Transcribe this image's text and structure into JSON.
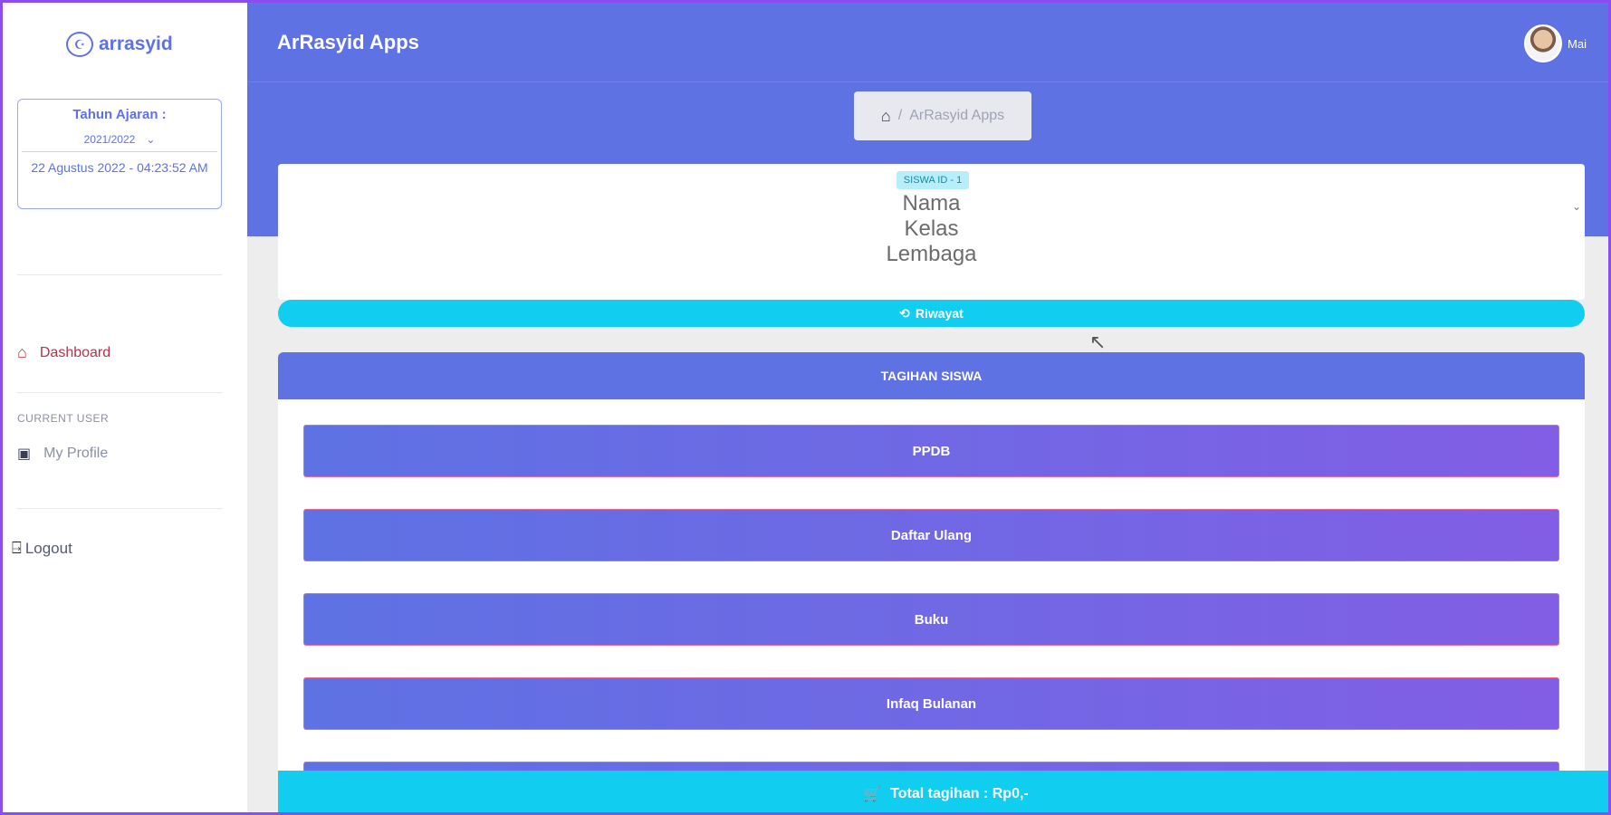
{
  "sidebar": {
    "brand": "arrasyid",
    "year_box": {
      "title": "Tahun Ajaran :",
      "selected_year": "2021/2022",
      "date": "22 Agustus 2022 - 04:23:52 AM"
    },
    "nav": {
      "dashboard": "Dashboard",
      "heading": "CURRENT USER",
      "profile": "My Profile",
      "logout": "Logout"
    }
  },
  "header": {
    "title": "ArRasyid Apps",
    "user_name": "Mai",
    "breadcrumb": "ArRasyid Apps"
  },
  "student": {
    "badge": "SISWA ID - 1",
    "name": "Nama",
    "class": "Kelas",
    "institution": "Lembaga",
    "history_button": "Riwayat"
  },
  "bills": {
    "title": "TAGIHAN SISWA",
    "items": [
      "PPDB",
      "Daftar Ulang",
      "Buku",
      "Infaq Bulanan",
      ""
    ]
  },
  "footer": {
    "total_label": "Total tagihan : Rp0,-"
  },
  "colors": {
    "primary": "#5e72e4",
    "info": "#11cdef",
    "gradient_end": "#825ee4"
  }
}
